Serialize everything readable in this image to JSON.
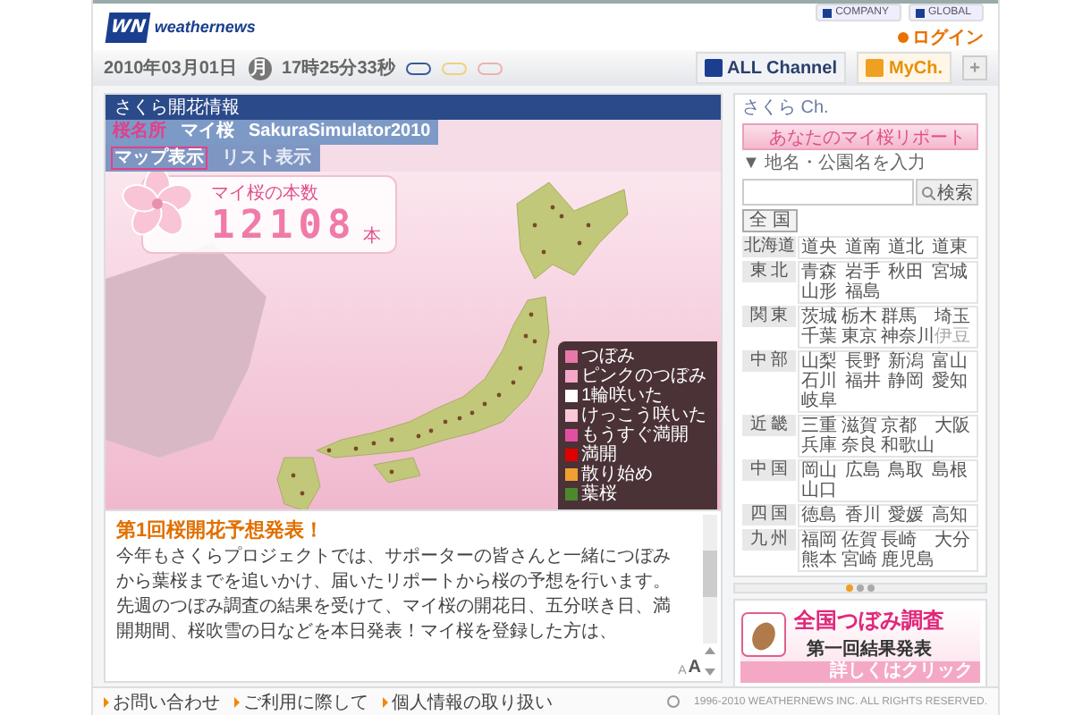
{
  "header": {
    "brand": "weathernews",
    "logo_mark": "WN",
    "top_links": [
      "COMPANY",
      "GLOBAL"
    ],
    "login": "ログイン"
  },
  "date_bar": {
    "date": "2010年03月01日",
    "weekday": "月",
    "time": "17時25分33秒",
    "channels": [
      {
        "label": "ALL Channel",
        "selected": false
      },
      {
        "label": "MyCh.",
        "selected": true
      }
    ],
    "add": "+"
  },
  "main": {
    "title": "さくら開花情報",
    "tabs": [
      {
        "label": "桜名所",
        "selected": true
      },
      {
        "label": "マイ桜",
        "selected": false
      },
      {
        "label": "SakuraSimulator2010",
        "selected": false
      }
    ],
    "view_tabs": [
      {
        "label": "マップ表示",
        "selected": true
      },
      {
        "label": "リスト表示",
        "selected": false
      }
    ],
    "counter": {
      "label": "マイ桜の本数",
      "value": "12108",
      "unit": "本"
    },
    "legend": [
      {
        "label": "つぼみ",
        "color": "#e878a8"
      },
      {
        "label": "ピンクのつぼみ",
        "color": "#f4a8c8"
      },
      {
        "label": "1輪咲いた",
        "color": "#ffffff"
      },
      {
        "label": "けっこう咲いた",
        "color": "#f8c8d8"
      },
      {
        "label": "もうすぐ満開",
        "color": "#e050a0"
      },
      {
        "label": "満開",
        "color": "#e00000"
      },
      {
        "label": "散り始め",
        "color": "#f0a030"
      },
      {
        "label": "葉桜",
        "color": "#4a8a2a"
      }
    ],
    "news": {
      "title": "第1回桜開花予想発表！",
      "body": "今年もさくらプロジェクトでは、サポーターの皆さんと一緒につぼみから葉桜までを追いかけ、届いたリポートから桜の予想を行います。先週のつぼみ調査の結果を受けて、マイ桜の開花日、五分咲き日、満開期間、桜吹雪の日などを本日発表！マイ桜を登録した方は、",
      "font_sizes": [
        "A",
        "A"
      ]
    }
  },
  "side": {
    "title": "さくら Ch.",
    "report_button": "あなたのマイ桜リポート",
    "search_label": "▼ 地名・公園名を入力",
    "search_button": "検索",
    "all_button": "全 国",
    "regions": [
      {
        "name": "北海道",
        "areas": [
          {
            "label": "道央",
            "disabled": false
          },
          {
            "label": "道南",
            "disabled": false
          },
          {
            "label": "道北",
            "disabled": false
          },
          {
            "label": "道東",
            "disabled": false
          }
        ]
      },
      {
        "name": "東 北",
        "areas": [
          {
            "label": "青森",
            "disabled": false
          },
          {
            "label": "岩手",
            "disabled": false
          },
          {
            "label": "秋田",
            "disabled": false
          },
          {
            "label": "宮城",
            "disabled": false
          },
          {
            "label": "山形",
            "disabled": false
          },
          {
            "label": "福島",
            "disabled": false
          }
        ]
      },
      {
        "name": "関 東",
        "areas": [
          {
            "label": "茨城",
            "disabled": false
          },
          {
            "label": "栃木",
            "disabled": false
          },
          {
            "label": "群馬",
            "disabled": false
          },
          {
            "label": "埼玉",
            "disabled": false
          },
          {
            "label": "千葉",
            "disabled": false
          },
          {
            "label": "東京",
            "disabled": false
          },
          {
            "label": "神奈川",
            "disabled": false
          },
          {
            "label": "伊豆",
            "disabled": true
          }
        ]
      },
      {
        "name": "中 部",
        "areas": [
          {
            "label": "山梨",
            "disabled": false
          },
          {
            "label": "長野",
            "disabled": false
          },
          {
            "label": "新潟",
            "disabled": false
          },
          {
            "label": "富山",
            "disabled": false
          },
          {
            "label": "石川",
            "disabled": false
          },
          {
            "label": "福井",
            "disabled": false
          },
          {
            "label": "静岡",
            "disabled": false
          },
          {
            "label": "愛知",
            "disabled": false
          },
          {
            "label": "岐阜",
            "disabled": false
          }
        ]
      },
      {
        "name": "近 畿",
        "areas": [
          {
            "label": "三重",
            "disabled": false
          },
          {
            "label": "滋賀",
            "disabled": false
          },
          {
            "label": "京都",
            "disabled": false
          },
          {
            "label": "大阪",
            "disabled": false
          },
          {
            "label": "兵庫",
            "disabled": false
          },
          {
            "label": "奈良",
            "disabled": false
          },
          {
            "label": "和歌山",
            "disabled": false
          }
        ]
      },
      {
        "name": "中 国",
        "areas": [
          {
            "label": "岡山",
            "disabled": false
          },
          {
            "label": "広島",
            "disabled": false
          },
          {
            "label": "鳥取",
            "disabled": false
          },
          {
            "label": "島根",
            "disabled": false
          },
          {
            "label": "山口",
            "disabled": false
          }
        ]
      },
      {
        "name": "四 国",
        "areas": [
          {
            "label": "徳島",
            "disabled": false
          },
          {
            "label": "香川",
            "disabled": false
          },
          {
            "label": "愛媛",
            "disabled": false
          },
          {
            "label": "高知",
            "disabled": false
          }
        ]
      },
      {
        "name": "九 州",
        "areas": [
          {
            "label": "福岡",
            "disabled": false
          },
          {
            "label": "佐賀",
            "disabled": false
          },
          {
            "label": "長崎",
            "disabled": false
          },
          {
            "label": "大分",
            "disabled": false
          },
          {
            "label": "熊本",
            "disabled": false
          },
          {
            "label": "宮崎",
            "disabled": false
          },
          {
            "label": "鹿児島",
            "disabled": false
          }
        ]
      }
    ],
    "pages": [
      {
        "selected": true
      },
      {
        "selected": false
      },
      {
        "selected": false
      }
    ],
    "banner": {
      "title": "全国つぼみ調査",
      "subtitle": "第一回結果発表",
      "link": "詳しくはクリック"
    }
  },
  "footer": {
    "links": [
      "お問い合わせ",
      "ご利用に際して",
      "個人情報の取り扱い"
    ],
    "copyright": "1996-2010 WEATHERNEWS INC. ALL RIGHTS RESERVED."
  }
}
